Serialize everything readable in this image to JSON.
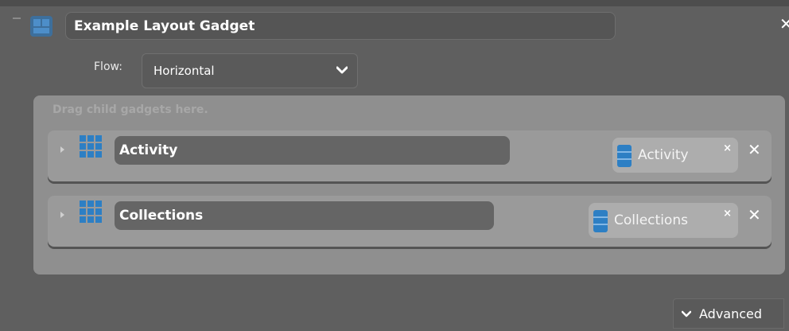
{
  "gadget": {
    "title": "Example Layout Gadget",
    "close_symbol": "✕"
  },
  "flow": {
    "label": "Flow:",
    "value": "Horizontal"
  },
  "drop_zone": {
    "hint": "Drag child gadgets here."
  },
  "children": [
    {
      "name": "Activity",
      "datasource": "Activity",
      "chip_remove": "×",
      "row_remove": "✕"
    },
    {
      "name": "Collections",
      "datasource": "Collections",
      "chip_remove": "×",
      "row_remove": "✕"
    }
  ],
  "advanced": {
    "label": "Advanced"
  },
  "colors": {
    "background": "#5f5f5f",
    "panel": "#8f8f8f",
    "row": "#9a9a9a",
    "accent_blue": "#2d7fc4"
  }
}
